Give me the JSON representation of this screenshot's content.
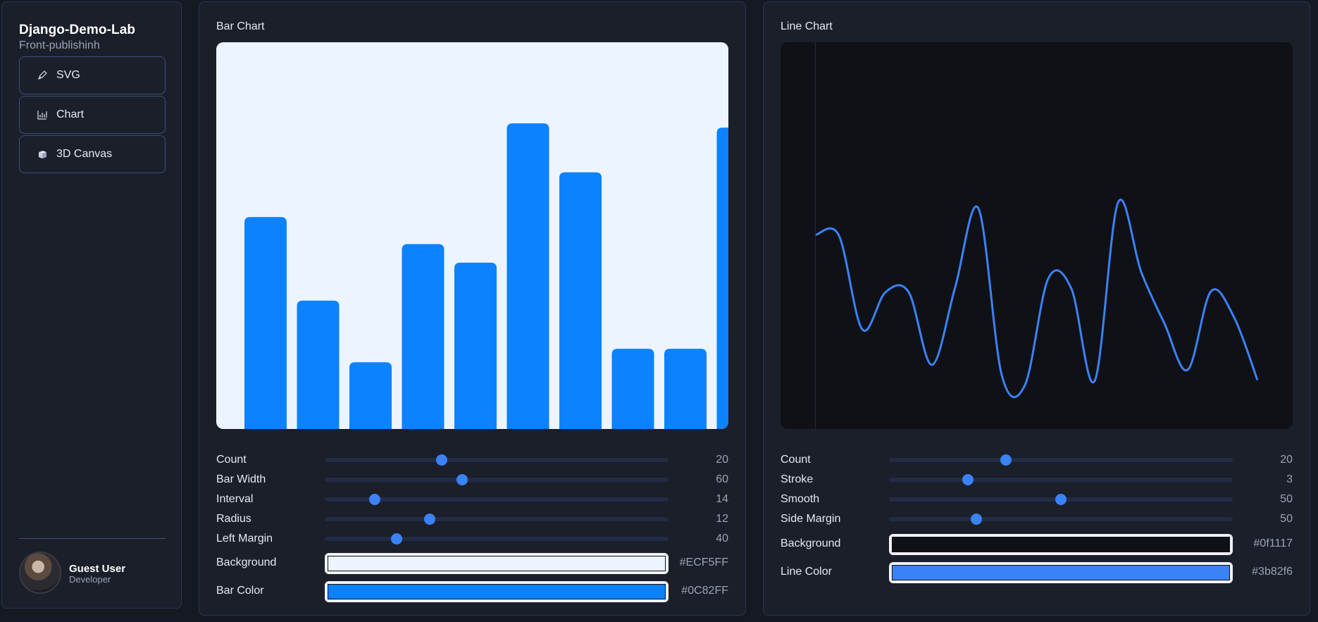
{
  "app": {
    "title": "Django-Demo-Lab",
    "subtitle": "Front-publishinh"
  },
  "nav": [
    {
      "label": "SVG",
      "icon": "pen-icon"
    },
    {
      "label": "Chart",
      "icon": "chart-icon"
    },
    {
      "label": "3D Canvas",
      "icon": "cube-icon"
    }
  ],
  "user": {
    "name": "Guest User",
    "role": "Developer"
  },
  "bar_panel": {
    "title": "Bar Chart",
    "controls": [
      {
        "label": "Count",
        "value": "20",
        "fraction": 0.34
      },
      {
        "label": "Bar Width",
        "value": "60",
        "fraction": 0.4
      },
      {
        "label": "Interval",
        "value": "14",
        "fraction": 0.145
      },
      {
        "label": "Radius",
        "value": "12",
        "fraction": 0.305
      },
      {
        "label": "Left Margin",
        "value": "40",
        "fraction": 0.21
      }
    ],
    "colors": [
      {
        "label": "Background",
        "value": "#ECF5FF",
        "hex": "#ECF5FF"
      },
      {
        "label": "Bar Color",
        "value": "#0C82FF",
        "hex": "#0C82FF"
      }
    ]
  },
  "line_panel": {
    "title": "Line Chart",
    "controls": [
      {
        "label": "Count",
        "value": "20",
        "fraction": 0.34
      },
      {
        "label": "Stroke",
        "value": "3",
        "fraction": 0.23
      },
      {
        "label": "Smooth",
        "value": "50",
        "fraction": 0.5
      },
      {
        "label": "Side Margin",
        "value": "50",
        "fraction": 0.255
      }
    ],
    "colors": [
      {
        "label": "Background",
        "value": "#0f1117",
        "hex": "#0f1117"
      },
      {
        "label": "Line Color",
        "value": "#3b82f6",
        "hex": "#3b82f6"
      }
    ]
  },
  "chart_data": [
    {
      "type": "bar",
      "values": [
        251,
        152,
        79,
        219,
        197,
        362,
        304,
        95,
        95,
        357
      ],
      "ylim": [
        0,
        458
      ],
      "bar_color": "#0C82FF",
      "background": "#ECF5FF"
    },
    {
      "type": "line",
      "values": [
        230,
        229,
        118,
        162,
        162,
        76,
        168,
        261,
        64,
        52,
        178,
        166,
        57,
        268,
        186,
        125,
        70,
        163,
        132,
        58
      ],
      "ylim": [
        0,
        458
      ],
      "line_color": "#3b82f6",
      "background": "#0f1117"
    }
  ]
}
